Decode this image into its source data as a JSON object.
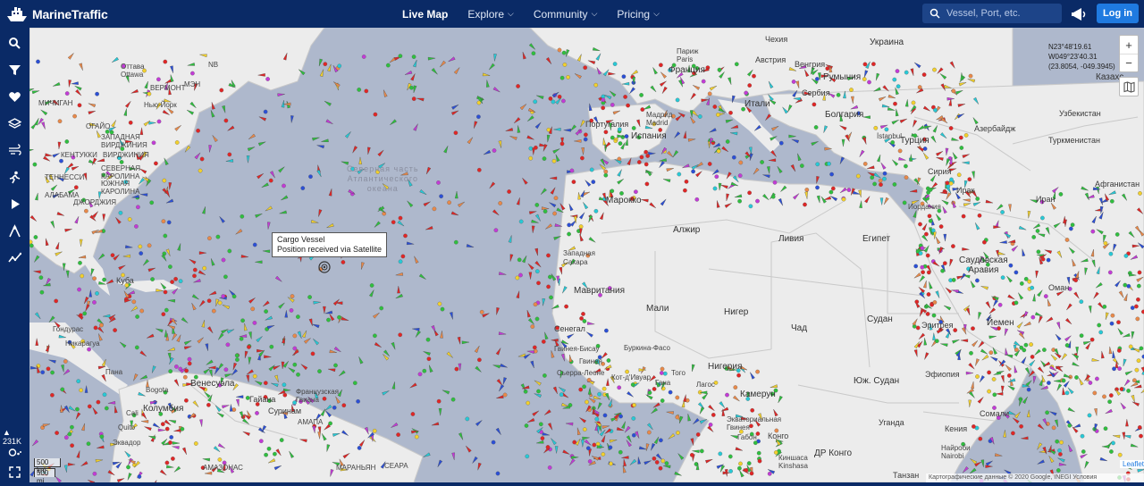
{
  "header": {
    "brand": "MarineTraffic",
    "nav": [
      "Live Map",
      "Explore",
      "Community",
      "Pricing"
    ],
    "search_placeholder": "Vessel, Port, etc.",
    "login_label": "Log in"
  },
  "sidebar": {
    "icons": [
      "search-icon",
      "filter-icon",
      "heart-icon",
      "layers-icon",
      "wind-icon",
      "route-icon",
      "play-icon",
      "weather-icon",
      "chart-icon"
    ],
    "vessel_count": "231K",
    "bottom_icons": [
      "vessel-toggle-icon",
      "fullscreen-icon"
    ]
  },
  "map": {
    "tooltip_title": "Cargo Vessel",
    "tooltip_text": "Position received via Satellite",
    "coords": [
      "N23°48'19.61",
      "W049°23'40.31",
      "(23.8054, -049.3945)"
    ],
    "zoom_in": "+",
    "zoom_out": "−",
    "scale_km": "500 km",
    "scale_mi": "500 mi",
    "attribution": "Картографические данные © 2020 Google, INEGI   Условия использования",
    "leaflet": "Leaflet",
    "ocean_label": "Северная часть\nАтлантического\nокеана",
    "labels": {
      "ukraine": "Украина",
      "kazakhstan": "Казахс",
      "czech": "Чехия",
      "paris": "Париж\nParis",
      "france": "Франция",
      "austria": "Австрия",
      "hungary": "Венгрия",
      "romania": "Румыния",
      "serbia": "Сербия",
      "bulgaria": "Болгария",
      "italy": "Итали",
      "madrid": "Мадрид\nMadrid",
      "portugal": "Португалия",
      "spain": "Испания",
      "istanbul": "İstanbul",
      "turkey": "Турция",
      "azerbaijan": "Азербайдж",
      "uzbekistan": "Узбекистан",
      "turkmenistan": "Туркменистан",
      "syria": "Сирия",
      "iraq": "Ирак",
      "afghanistan": "Афганистан",
      "iran": "Иран",
      "jordan": "Иордания",
      "morocco": "Марокко",
      "algeria": "Алжир",
      "libya": "Ливия",
      "egypt": "Египет",
      "saudi": "Саудовская\nАравия",
      "oman": "Оман",
      "west_sahara": "Западная\nСахара",
      "mauritania": "Мавритания",
      "mali": "Мали",
      "niger": "Нигер",
      "chad": "Чад",
      "sudan": "Судан",
      "eritrea": "Эритрея",
      "yemen": "Йемен",
      "senegal": "Сенегал",
      "burkina": "Буркина-Фасо",
      "nigeria": "Нигерия",
      "ethiopia": "Эфиопия",
      "sierra": "Сьерра-Леоне",
      "ivory": "Кот-д'Ивуар",
      "ghana": "Гана",
      "togo": "Того",
      "guinea_bissau": "Гвинея-Бисау",
      "guinea": "Гвинея",
      "cameroon": "Камерун",
      "south_sudan": "Юж. Судан",
      "uganda": "Уганда",
      "kenya": "Кения",
      "somalia": "Сомали",
      "nairobi": "Найроби\nNairobi",
      "drc": "ДР Конго",
      "congo": "Конго",
      "gabon": "Габон",
      "kinshasa": "Киншаса\nKinshasa",
      "equatorial_guinea": "Экваториальная\nГвинея",
      "lagos": "Лагос",
      "tanzania": "Танзан",
      "venezuela": "Венесуэла",
      "colombia": "Колумбия",
      "bogota": "Bogota",
      "guyana": "Гайана",
      "suriname": "Суринам",
      "french_guiana": "Французская\nГвиана",
      "ecuador": "Эквадор",
      "quito": "Quito",
      "amapa": "АМАПА",
      "amazonas": "АМАЗОНАС",
      "maranhao": "МАРАНЬЯН",
      "ceara": "СЕАРА",
      "cuba": "Куба",
      "honduras": "Гондурас",
      "nicaragua": "Никарагуа",
      "panama": "Пана",
      "cali": "Cali",
      "ottawa": "Оттава\nOttawa",
      "new_york": "Нью-Йорк",
      "vermont": "ВЕРМОНТ",
      "michigan": "МИЧИГАН",
      "ohio": "ОГАЙО",
      "virginia": "ВИРДЖИНИЯ",
      "kentucky": "КЕНТУККИ",
      "nc": "СЕВЕРНАЯ\nКАРОЛИНА",
      "sc": "ЮЖНАЯ\nКАРОЛИНА",
      "georgia": "ДЖОРДЖИЯ",
      "alabama": "АЛАБАМА",
      "tennessee": "ТЕННЕССИ",
      "wv": "ЗАПАДНАЯ\nВИРДЖИНИЯ",
      "nb": "NB",
      "me": "МЭН"
    }
  }
}
